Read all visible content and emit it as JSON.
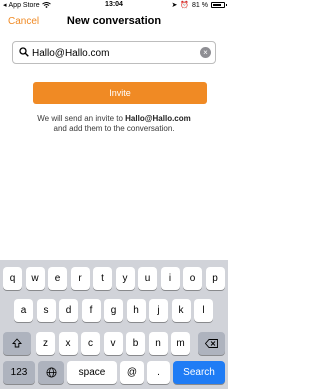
{
  "status": {
    "carrier": "App Store",
    "time": "13:04",
    "battery": "81 %",
    "battery_level": 0.81
  },
  "nav": {
    "cancel": "Cancel",
    "title": "New conversation"
  },
  "search": {
    "value": "Hallo@Hallo.com",
    "clear_glyph": "×"
  },
  "invite_button": "Invite",
  "invite_text": {
    "prefix": "We will send an invite to ",
    "email": "Hallo@Hallo.com",
    "suffix": "and add them to the conversation."
  },
  "keyboard": {
    "row1": [
      "q",
      "w",
      "e",
      "r",
      "t",
      "y",
      "u",
      "i",
      "o",
      "p"
    ],
    "row2": [
      "a",
      "s",
      "d",
      "f",
      "g",
      "h",
      "j",
      "k",
      "l"
    ],
    "row3": [
      "z",
      "x",
      "c",
      "v",
      "b",
      "n",
      "m"
    ],
    "numbers_label": "123",
    "space_label": "space",
    "at_label": "@",
    "dot_label": ".",
    "search_label": "Search"
  },
  "colors": {
    "accent": "#f08a24",
    "keyboard_bg": "#d1d3d9",
    "search_key": "#1f7cf5"
  }
}
